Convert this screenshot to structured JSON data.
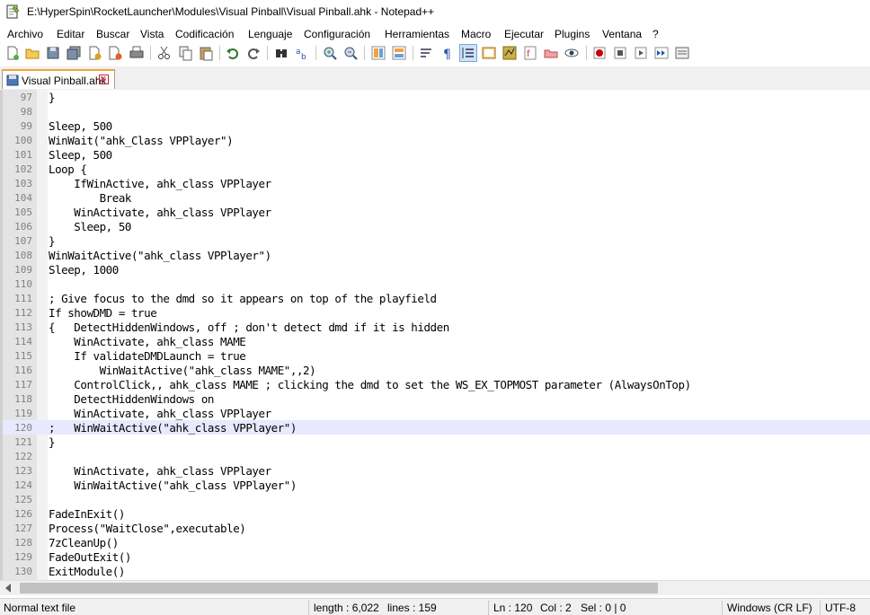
{
  "window": {
    "title": "E:\\HyperSpin\\RocketLauncher\\Modules\\Visual Pinball\\Visual Pinball.ahk - Notepad++",
    "app_icon": "notepad-plus-plus-icon"
  },
  "menu": [
    "Archivo",
    "Editar",
    "Buscar",
    "Vista",
    "Codificación",
    "Lenguaje",
    "Configuración",
    "Herramientas",
    "Macro",
    "Ejecutar",
    "Plugins",
    "Ventana",
    "?"
  ],
  "toolbar": {
    "buttons": [
      "new-file-icon",
      "open-file-icon",
      "save-icon",
      "save-all-icon",
      "close-icon",
      "close-all-icon",
      "print-icon",
      "cut-icon",
      "copy-icon",
      "paste-icon",
      "undo-icon",
      "redo-icon",
      "find-icon",
      "replace-icon",
      "zoom-in-icon",
      "zoom-out-icon",
      "sync-vertical-icon",
      "sync-horizontal-icon",
      "word-wrap-icon",
      "show-all-characters-icon",
      "indent-guide-icon",
      "function-list-icon",
      "document-map-icon",
      "folder-workspace-icon",
      "document-list-icon",
      "monitoring-eye-icon",
      "record-macro-icon",
      "stop-macro-icon",
      "play-macro-icon",
      "run-macro-multiple-icon",
      "save-macro-icon"
    ]
  },
  "tab": {
    "label": "Visual Pinball.ahk",
    "icon": "file-saved-icon"
  },
  "editor": {
    "current_line": 120,
    "lines": [
      {
        "n": "97",
        "text": "}"
      },
      {
        "n": "98",
        "text": ""
      },
      {
        "n": "99",
        "text": "Sleep, 500"
      },
      {
        "n": "100",
        "text": "WinWait(\"ahk_Class VPPlayer\")"
      },
      {
        "n": "101",
        "text": "Sleep, 500"
      },
      {
        "n": "102",
        "text": "Loop {"
      },
      {
        "n": "103",
        "text": "    IfWinActive, ahk_class VPPlayer"
      },
      {
        "n": "104",
        "text": "        Break"
      },
      {
        "n": "105",
        "text": "    WinActivate, ahk_class VPPlayer"
      },
      {
        "n": "106",
        "text": "    Sleep, 50"
      },
      {
        "n": "107",
        "text": "}"
      },
      {
        "n": "108",
        "text": "WinWaitActive(\"ahk_class VPPlayer\")"
      },
      {
        "n": "109",
        "text": "Sleep, 1000"
      },
      {
        "n": "110",
        "text": ""
      },
      {
        "n": "111",
        "text": "; Give focus to the dmd so it appears on top of the playfield"
      },
      {
        "n": "112",
        "text": "If showDMD = true"
      },
      {
        "n": "113",
        "text": "{   DetectHiddenWindows, off ; don't detect dmd if it is hidden"
      },
      {
        "n": "114",
        "text": "    WinActivate, ahk_class MAME"
      },
      {
        "n": "115",
        "text": "    If validateDMDLaunch = true"
      },
      {
        "n": "116",
        "text": "        WinWaitActive(\"ahk_class MAME\",,2)"
      },
      {
        "n": "117",
        "text": "    ControlClick,, ahk_class MAME ; clicking the dmd to set the WS_EX_TOPMOST parameter (AlwaysOnTop)"
      },
      {
        "n": "118",
        "text": "    DetectHiddenWindows on"
      },
      {
        "n": "119",
        "text": "    WinActivate, ahk_class VPPlayer"
      },
      {
        "n": "120",
        "text": ";   WinWaitActive(\"ahk_class VPPlayer\")"
      },
      {
        "n": "121",
        "text": "}"
      },
      {
        "n": "122",
        "text": ""
      },
      {
        "n": "123",
        "text": "    WinActivate, ahk_class VPPlayer"
      },
      {
        "n": "124",
        "text": "    WinWaitActive(\"ahk_class VPPlayer\")"
      },
      {
        "n": "125",
        "text": ""
      },
      {
        "n": "126",
        "text": "FadeInExit()"
      },
      {
        "n": "127",
        "text": "Process(\"WaitClose\",executable)"
      },
      {
        "n": "128",
        "text": "7zCleanUp()"
      },
      {
        "n": "129",
        "text": "FadeOutExit()"
      },
      {
        "n": "130",
        "text": "ExitModule()"
      }
    ]
  },
  "status": {
    "file_type": "Normal text file",
    "length": "length : 6,022",
    "lines": "lines : 159",
    "ln": "Ln : 120",
    "col": "Col : 2",
    "sel": "Sel : 0 | 0",
    "eol": "Windows (CR LF)",
    "encoding": "UTF-8"
  },
  "colors": {
    "current_line": "#e8e8ff",
    "tab_accent": "#f3a43a",
    "gutter": "#e4e4e4"
  }
}
